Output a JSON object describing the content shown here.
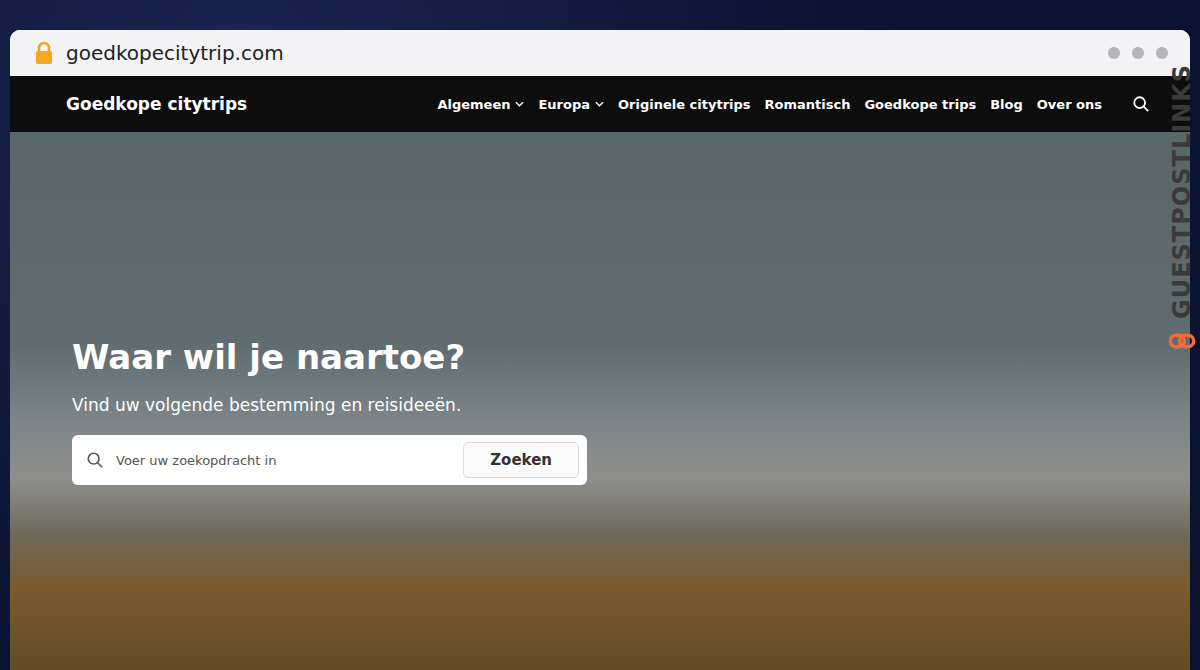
{
  "browser": {
    "url": "goedkopecitytrip.com",
    "secure": true
  },
  "nav": {
    "logo": "Goedkope citytrips",
    "items": [
      {
        "label": "Algemeen",
        "dropdown": true
      },
      {
        "label": "Europa",
        "dropdown": true
      },
      {
        "label": "Originele citytrips",
        "dropdown": false
      },
      {
        "label": "Romantisch",
        "dropdown": false
      },
      {
        "label": "Goedkope trips",
        "dropdown": false
      },
      {
        "label": "Blog",
        "dropdown": false
      },
      {
        "label": "Over ons",
        "dropdown": false
      }
    ]
  },
  "hero": {
    "title": "Waar wil je naartoe?",
    "subtitle": "Vind uw volgende bestemming en reisideeën.",
    "search": {
      "placeholder": "Voer uw zoekopdracht in",
      "button": "Zoeken"
    }
  },
  "watermark": {
    "text": "GUESTPOSTLINKS"
  }
}
